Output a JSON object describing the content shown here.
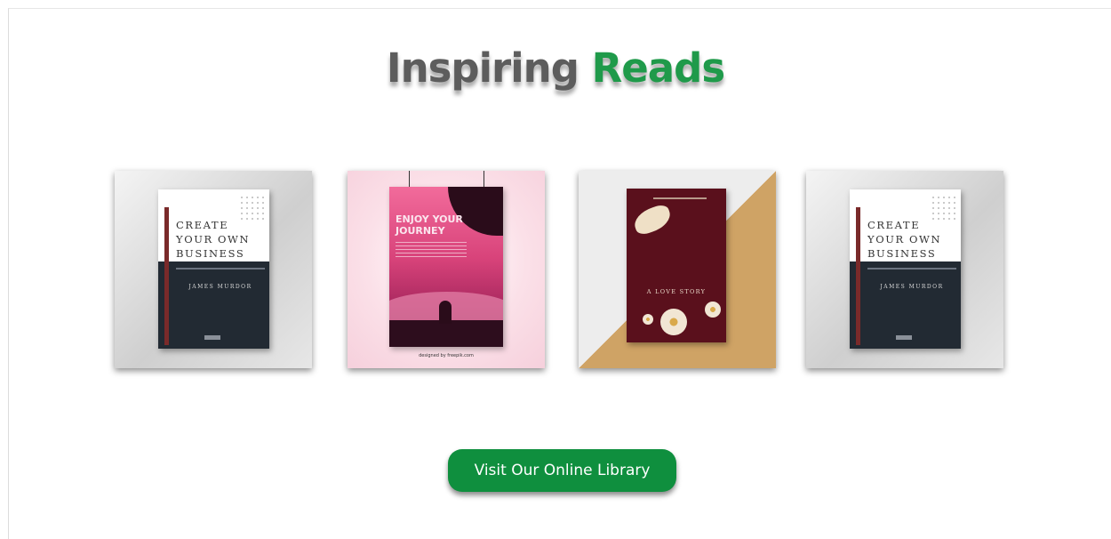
{
  "title": {
    "word1": "Inspiring",
    "word2": "Reads"
  },
  "colors": {
    "title_gray": "#5d5d5d",
    "title_green": "#1f9a4a",
    "button_green": "#0f8f3e"
  },
  "books": [
    {
      "title": "CREATE YOUR OWN BUSINESS",
      "author": "JAMES MURDOR"
    },
    {
      "title": "ENJOY YOUR JOURNEY",
      "credit": "designed by freepik.com"
    },
    {
      "title": "A LOVE STORY"
    },
    {
      "title": "CREATE YOUR OWN BUSINESS",
      "author": "JAMES MURDOR"
    }
  ],
  "cta": {
    "label": "Visit Our Online Library"
  }
}
